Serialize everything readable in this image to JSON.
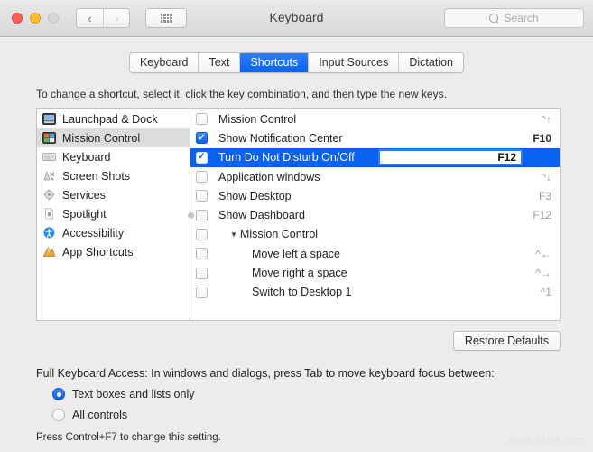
{
  "window": {
    "title": "Keyboard",
    "traffic_lights": [
      "close",
      "minimize",
      "zoom"
    ],
    "nav_back": "‹",
    "nav_forward": "›",
    "grid_button": "show-all",
    "search_placeholder": "Search"
  },
  "tabs": [
    {
      "label": "Keyboard",
      "active": false
    },
    {
      "label": "Text",
      "active": false
    },
    {
      "label": "Shortcuts",
      "active": true
    },
    {
      "label": "Input Sources",
      "active": false
    },
    {
      "label": "Dictation",
      "active": false
    }
  ],
  "instruction": "To change a shortcut, select it, click the key combination, and then type the new keys.",
  "sidebar": {
    "items": [
      {
        "label": "Launchpad & Dock",
        "icon": "launchpad-dock-icon",
        "selected": false
      },
      {
        "label": "Mission Control",
        "icon": "mission-control-icon",
        "selected": true
      },
      {
        "label": "Keyboard",
        "icon": "keyboard-icon",
        "selected": false
      },
      {
        "label": "Screen Shots",
        "icon": "screenshots-icon",
        "selected": false
      },
      {
        "label": "Services",
        "icon": "services-gear-icon",
        "selected": false
      },
      {
        "label": "Spotlight",
        "icon": "spotlight-icon",
        "selected": false
      },
      {
        "label": "Accessibility",
        "icon": "accessibility-icon",
        "selected": false
      },
      {
        "label": "App Shortcuts",
        "icon": "app-shortcuts-icon",
        "selected": false
      }
    ]
  },
  "shortcuts": {
    "rows": [
      {
        "label": "Mission Control",
        "keys": "^↑",
        "checked": false,
        "selected": false,
        "indent": "none",
        "group": false,
        "keys_strong": false
      },
      {
        "label": "Show Notification Center",
        "keys": "F10",
        "checked": true,
        "selected": false,
        "indent": "none",
        "group": false,
        "keys_strong": true
      },
      {
        "label": "Turn Do Not Disturb On/Off",
        "keys": "F12",
        "checked": true,
        "selected": true,
        "indent": "none",
        "group": false,
        "keys_strong": true,
        "editing": true
      },
      {
        "label": "Application windows",
        "keys": "^↓",
        "checked": false,
        "selected": false,
        "indent": "none",
        "group": false,
        "keys_strong": false
      },
      {
        "label": "Show Desktop",
        "keys": "F3",
        "checked": false,
        "selected": false,
        "indent": "none",
        "group": false,
        "keys_strong": false
      },
      {
        "label": "Show Dashboard",
        "keys": "F12",
        "checked": false,
        "selected": false,
        "indent": "none",
        "group": false,
        "keys_strong": false
      },
      {
        "label": "Mission Control",
        "keys": "",
        "checked": false,
        "selected": false,
        "indent": "group",
        "group": true,
        "keys_strong": false
      },
      {
        "label": "Move left a space",
        "keys": "^←",
        "checked": false,
        "selected": false,
        "indent": "indent",
        "group": false,
        "keys_strong": false
      },
      {
        "label": "Move right a space",
        "keys": "^→",
        "checked": false,
        "selected": false,
        "indent": "indent",
        "group": false,
        "keys_strong": false
      },
      {
        "label": "Switch to Desktop 1",
        "keys": "^1",
        "checked": false,
        "selected": false,
        "indent": "indent",
        "group": false,
        "keys_strong": false
      }
    ],
    "disclosure_glyph": "▼"
  },
  "restore_defaults_label": "Restore Defaults",
  "full_keyboard_access": {
    "description": "Full Keyboard Access: In windows and dialogs, press Tab to move keyboard focus between:",
    "options": [
      {
        "label": "Text boxes and lists only",
        "selected": true
      },
      {
        "label": "All controls",
        "selected": false
      }
    ],
    "hint": "Press Control+F7 to change this setting."
  },
  "watermark": "www.frfam.com",
  "colors": {
    "accent_blue": "#0a62f0",
    "tab_active": "#0b63f3",
    "window_bg": "#ececec",
    "panel_bg": "#ffffff",
    "sidebar_selected": "#dcdcdc"
  }
}
